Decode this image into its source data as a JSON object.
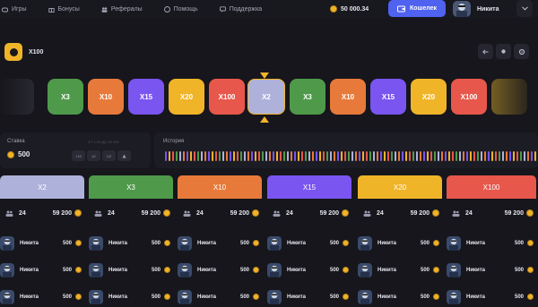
{
  "nav": [
    {
      "label": "Игры",
      "icon": "gamepad-icon"
    },
    {
      "label": "Бонусы",
      "icon": "gift-icon"
    },
    {
      "label": "Рефералы",
      "icon": "users-icon"
    },
    {
      "label": "Помощь",
      "icon": "help-icon"
    },
    {
      "label": "Поддержка",
      "icon": "chat-icon"
    }
  ],
  "header": {
    "balance": "50 000.34",
    "wallet_label": "Кошелек",
    "username": "Никита"
  },
  "game": {
    "title": "X100"
  },
  "reel": [
    {
      "label": "",
      "color": "#3a3a44"
    },
    {
      "label": "X3",
      "color": "#4f9a4a"
    },
    {
      "label": "X10",
      "color": "#e77a3a"
    },
    {
      "label": "X15",
      "color": "#7a55f0"
    },
    {
      "label": "X20",
      "color": "#f0b429"
    },
    {
      "label": "X100",
      "color": "#e7574b"
    },
    {
      "label": "X2",
      "color": "#aeb1da"
    },
    {
      "label": "X3",
      "color": "#4f9a4a"
    },
    {
      "label": "X10",
      "color": "#e77a3a"
    },
    {
      "label": "X15",
      "color": "#7a55f0"
    },
    {
      "label": "X20",
      "color": "#f0b429"
    },
    {
      "label": "X100",
      "color": "#e7574b"
    },
    {
      "label": "",
      "color": "#c19a2a"
    }
  ],
  "bet": {
    "label": "Ставка",
    "range_hint": "ОТ 1.00 ДО 20 000",
    "value": "500",
    "buttons": [
      "+10",
      "x2",
      "1/2",
      "max"
    ]
  },
  "history": {
    "label": "История",
    "colors": [
      "#7a55f0",
      "#e77a3a",
      "#f0b429",
      "#4f9a4a",
      "#e7574b",
      "#aeb1da"
    ]
  },
  "columns": [
    {
      "label": "X2",
      "color": "#aeb1da",
      "players": "24",
      "total": "59 200"
    },
    {
      "label": "X3",
      "color": "#4f9a4a",
      "players": "24",
      "total": "59 200"
    },
    {
      "label": "X10",
      "color": "#e77a3a",
      "players": "24",
      "total": "59 200"
    },
    {
      "label": "X15",
      "color": "#7a55f0",
      "players": "24",
      "total": "59 200"
    },
    {
      "label": "X20",
      "color": "#f0b429",
      "players": "24",
      "total": "59 200"
    },
    {
      "label": "X100",
      "color": "#e7574b",
      "players": "24",
      "total": "59 200"
    }
  ],
  "bet_row": {
    "name": "Никита",
    "amount": "500"
  }
}
